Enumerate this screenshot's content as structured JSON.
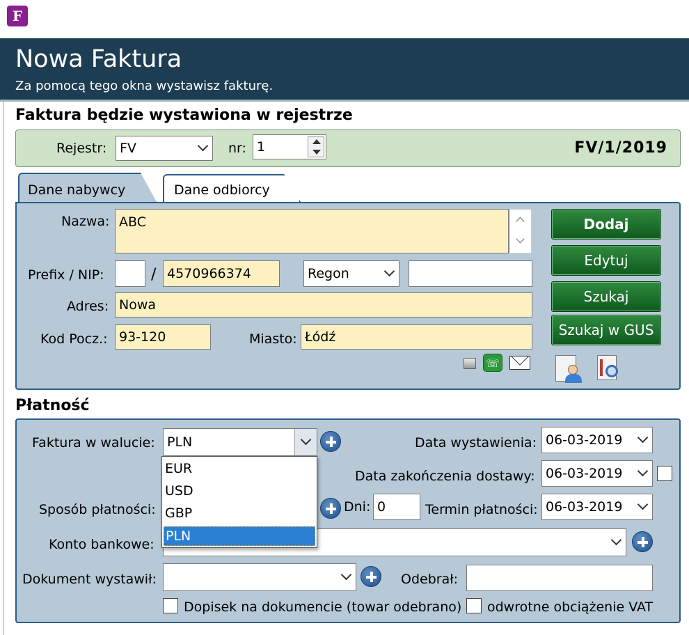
{
  "app_icon": "F",
  "header": {
    "title": "Nowa Faktura",
    "subtitle": "Za pomocą tego okna wystawisz fakturę."
  },
  "register_section": {
    "heading": "Faktura będzie wystawiona w rejestrze",
    "rejestr_label": "Rejestr:",
    "rejestr_value": "FV",
    "nr_label": "nr:",
    "nr_value": "1",
    "invoice_number": "FV/1/2019"
  },
  "tabs": [
    {
      "label": "Dane nabywcy",
      "active": true
    },
    {
      "label": "Dane odbiorcy",
      "active": false
    }
  ],
  "buyer": {
    "nazwa_label": "Nazwa:",
    "nazwa_value": "ABC",
    "prefix_nip_label": "Prefix / NIP:",
    "prefix_value": "",
    "slash": "/",
    "nip_value": "4570966374",
    "regon_select": "Regon",
    "regon_value": "",
    "adres_label": "Adres:",
    "adres_value": "Nowa",
    "kod_label": "Kod Pocz.:",
    "kod_value": "93-120",
    "miasto_label": "Miasto:",
    "miasto_value": "Łódź"
  },
  "buttons": {
    "dodaj": "Dodaj",
    "edytuj": "Edytuj",
    "szukaj": "Szukaj",
    "szukaj_gus": "Szukaj w GUS"
  },
  "payment": {
    "heading": "Płatność",
    "currency_label": "Faktura w walucie:",
    "currency_value": "PLN",
    "currency_options": [
      "EUR",
      "USD",
      "GBP",
      "PLN"
    ],
    "data_wyst_label": "Data wystawienia:",
    "data_wyst_value": "06-03-2019",
    "data_zak_label": "Data zakończenia dostawy:",
    "data_zak_value": "06-03-2019",
    "sposob_label": "Sposób płatności:",
    "dni_label": "Dni:",
    "dni_value": "0",
    "termin_label": "Termin płatności:",
    "termin_value": "06-03-2019",
    "konto_label": "Konto bankowe:",
    "konto_value": "",
    "dokument_label": "Dokument wystawił:",
    "dokument_value": "",
    "odebral_label": "Odebrał:",
    "odebral_value": "",
    "dopisek_label": "Dopisek na dokumencie (towar odebrano)",
    "vat_label": "odwrotne obciążenie VAT"
  },
  "colors": {
    "header_bg": "#1d3d52",
    "register_bg": "#cfe3c8",
    "panel_bg": "#b7c9d6",
    "yellow_field": "#fdf1c2",
    "green_button": "#1a6b2a",
    "selected_option": "#2a7fd4"
  }
}
